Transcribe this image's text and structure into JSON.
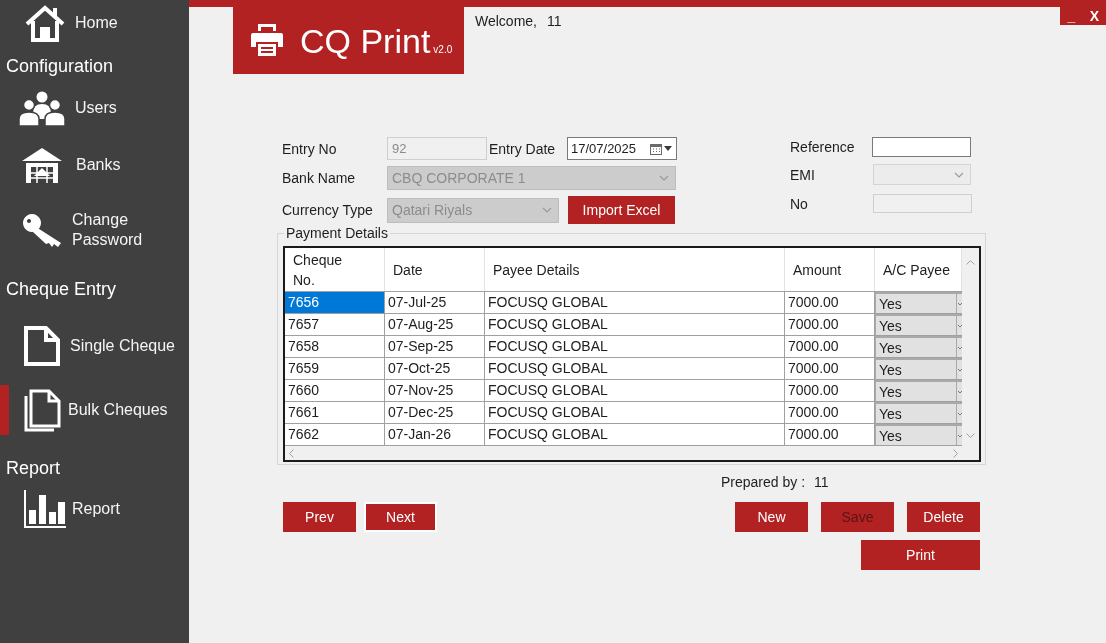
{
  "sidebar": {
    "sections": [
      {
        "items": [
          {
            "kind": "home",
            "label": "Home",
            "selected": false
          }
        ]
      },
      {
        "title": "Configuration",
        "items": [
          {
            "kind": "users",
            "label": "Users",
            "selected": false
          },
          {
            "kind": "banks",
            "label": "Banks",
            "selected": false
          },
          {
            "kind": "key",
            "label": "Change\nPassword",
            "selected": false
          }
        ]
      },
      {
        "title": "Cheque Entry",
        "items": [
          {
            "kind": "single_cheque",
            "label": "Single Cheque",
            "selected": false
          },
          {
            "kind": "bulk_cheques",
            "label": "Bulk Cheques",
            "selected": true
          }
        ]
      },
      {
        "title": "Report",
        "items": [
          {
            "kind": "report",
            "label": "Report",
            "selected": false
          }
        ]
      }
    ]
  },
  "header": {
    "app_name": "CQ Print",
    "version": "v2.0",
    "welcome": "Welcome,",
    "user": "11"
  },
  "window_controls": [
    {
      "label": "_"
    },
    {
      "label": "X"
    }
  ],
  "form": {
    "entry_no": {
      "label": "Entry No",
      "value": "92",
      "disabled": true
    },
    "entry_date": {
      "label": "Entry Date",
      "value": "17/07/2025"
    },
    "bank_name": {
      "label": "Bank Name",
      "value": "CBQ CORPORATE 1",
      "disabled": true
    },
    "currency_type": {
      "label": "Currency Type",
      "value": "Qatari Riyals",
      "disabled": true
    },
    "import_button": {
      "label": "Import Excel"
    },
    "reference": {
      "label": "Reference",
      "disabled": false
    },
    "emi": {
      "label": "EMI",
      "disabled": true
    },
    "no": {
      "label": "No",
      "disabled": true
    }
  },
  "payment_details": {
    "title": "Payment Details",
    "columns": [
      "Cheque No.",
      "Date",
      "Payee Details",
      "Amount",
      "A/C Payee"
    ],
    "rows": [
      {
        "cells": [
          "7656",
          "07-Jul-25",
          "FOCUSQ GLOBAL",
          "7000.00"
        ],
        "ac_payee": "Yes",
        "selected": true
      },
      {
        "cells": [
          "7657",
          "07-Aug-25",
          "FOCUSQ GLOBAL",
          "7000.00"
        ],
        "ac_payee": "Yes",
        "selected": false
      },
      {
        "cells": [
          "7658",
          "07-Sep-25",
          "FOCUSQ GLOBAL",
          "7000.00"
        ],
        "ac_payee": "Yes",
        "selected": false
      },
      {
        "cells": [
          "7659",
          "07-Oct-25",
          "FOCUSQ GLOBAL",
          "7000.00"
        ],
        "ac_payee": "Yes",
        "selected": false
      },
      {
        "cells": [
          "7660",
          "07-Nov-25",
          "FOCUSQ GLOBAL",
          "7000.00"
        ],
        "ac_payee": "Yes",
        "selected": false
      },
      {
        "cells": [
          "7661",
          "07-Dec-25",
          "FOCUSQ GLOBAL",
          "7000.00"
        ],
        "ac_payee": "Yes",
        "selected": false
      },
      {
        "cells": [
          "7662",
          "07-Jan-26",
          "FOCUSQ GLOBAL",
          "7000.00"
        ],
        "ac_payee": "Yes",
        "selected": false
      }
    ]
  },
  "prepared_by": {
    "label": "Prepared by :",
    "value": "11"
  },
  "nav_buttons": [
    {
      "label": "Prev",
      "focused": false
    },
    {
      "label": "Next",
      "focused": true
    }
  ],
  "action_buttons": [
    {
      "label": "New",
      "disabled": false
    },
    {
      "label": "Save",
      "disabled": true
    },
    {
      "label": "Delete",
      "disabled": false
    }
  ],
  "print_button": {
    "label": "Print",
    "disabled": false
  }
}
